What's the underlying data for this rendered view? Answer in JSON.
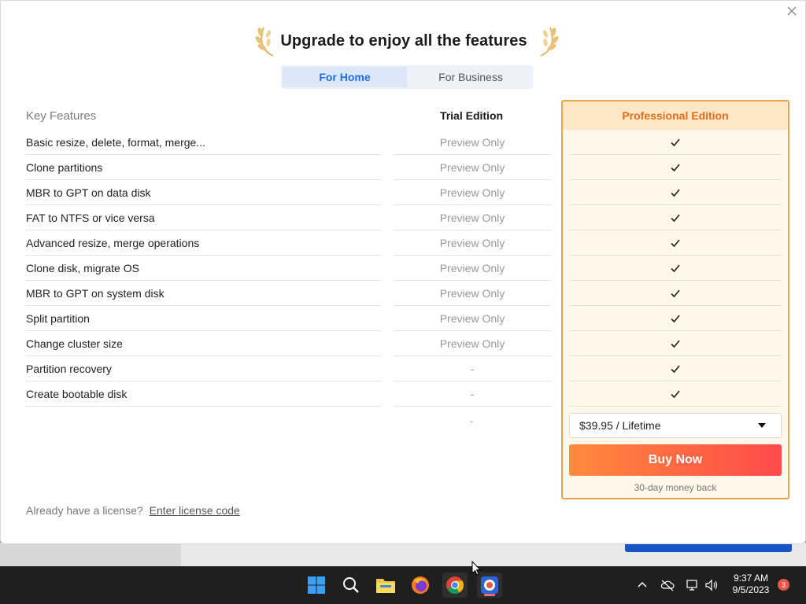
{
  "dialog": {
    "title": "Upgrade to enjoy all the features",
    "tabs": [
      {
        "label": "For Home",
        "active": true
      },
      {
        "label": "For Business",
        "active": false
      }
    ]
  },
  "table": {
    "headers": {
      "features": "Key Features",
      "trial": "Trial Edition",
      "pro": "Professional Edition"
    },
    "rows": [
      {
        "feature": "Basic resize, delete, format, merge...",
        "trial": "Preview Only",
        "pro": "✓"
      },
      {
        "feature": "Clone partitions",
        "trial": "Preview Only",
        "pro": "✓"
      },
      {
        "feature": "MBR to GPT on data disk",
        "trial": "Preview Only",
        "pro": "✓"
      },
      {
        "feature": "FAT to NTFS or vice versa",
        "trial": "Preview Only",
        "pro": "✓"
      },
      {
        "feature": "Advanced resize, merge operations",
        "trial": "Preview Only",
        "pro": "✓"
      },
      {
        "feature": "Clone disk, migrate OS",
        "trial": "Preview Only",
        "pro": "✓"
      },
      {
        "feature": "MBR to GPT on system disk",
        "trial": "Preview Only",
        "pro": "✓"
      },
      {
        "feature": "Split partition",
        "trial": "Preview Only",
        "pro": "✓"
      },
      {
        "feature": "Change cluster size",
        "trial": "Preview Only",
        "pro": "✓"
      },
      {
        "feature": "Partition recovery",
        "trial": "-",
        "pro": "✓"
      },
      {
        "feature": "Create bootable disk",
        "trial": "-",
        "pro": "✓"
      }
    ],
    "trial_price": "-"
  },
  "pro_panel": {
    "price_select": "$39.95 / Lifetime",
    "buy_label": "Buy Now",
    "money_back": "30-day money back"
  },
  "license": {
    "prompt": "Already have a license?",
    "link": "Enter license code"
  },
  "taskbar": {
    "time": "9:37 AM",
    "date": "9/5/2023",
    "notification_count": "3"
  },
  "colors": {
    "accent_blue": "#1f6fe5",
    "pro_orange": "#e36b1e",
    "buy_gradient_start": "#ff8a3c",
    "buy_gradient_end": "#ff4a4a"
  }
}
